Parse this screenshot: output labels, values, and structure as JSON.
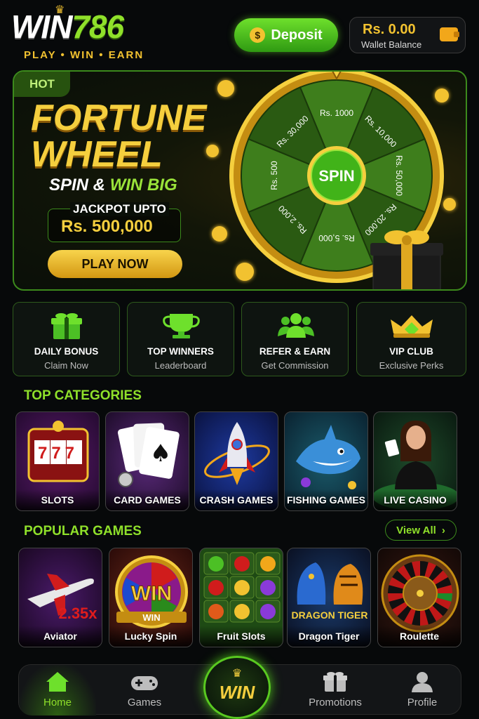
{
  "header": {
    "logo_win": "WIN",
    "logo_num": "786",
    "tagline": "PLAY • WIN • EARN",
    "deposit_label": "Deposit",
    "wallet_amount": "Rs. 0.00",
    "wallet_label": "Wallet Balance"
  },
  "banner": {
    "badge": "HOT",
    "title_line1": "FORTUNE",
    "title_line2": "WHEEL",
    "subtitle_a": "SPIN &",
    "subtitle_b": "WIN BIG",
    "jackpot_label": "JACKPOT UPTO",
    "jackpot_amount": "Rs. 500,000",
    "cta": "PLAY NOW",
    "spin_label": "SPIN",
    "wheel_prizes": [
      "Rs. 1000",
      "Rs. 10,000",
      "Rs. 50,000",
      "Rs. 20,000",
      "Rs. 5,000",
      "Rs. 2,000",
      "Rs. 500",
      "Rs. 30,000"
    ]
  },
  "quick_actions": [
    {
      "title": "DAILY BONUS",
      "subtitle": "Claim Now",
      "icon": "gift-icon"
    },
    {
      "title": "TOP WINNERS",
      "subtitle": "Leaderboard",
      "icon": "trophy-icon"
    },
    {
      "title": "REFER & EARN",
      "subtitle": "Get Commission",
      "icon": "users-icon"
    },
    {
      "title": "VIP CLUB",
      "subtitle": "Exclusive Perks",
      "icon": "crown-icon"
    }
  ],
  "categories": {
    "title": "TOP CATEGORIES",
    "items": [
      "SLOTS",
      "CARD GAMES",
      "CRASH GAMES",
      "FISHING GAMES",
      "LIVE CASINO"
    ]
  },
  "popular": {
    "title": "POPULAR GAMES",
    "view_all": "View All",
    "items": [
      "Aviator",
      "Lucky Spin",
      "Fruit Slots",
      "Dragon Tiger",
      "Roulette"
    ],
    "aviator_multiplier": "2.35x",
    "lucky_spin_art": "WIN",
    "lucky_spin_art2": "WIN",
    "dragon_tiger_art": "DRAGON TIGER",
    "slot_art": "777"
  },
  "nav": {
    "items": [
      "Home",
      "Games",
      "Promotions",
      "Profile"
    ],
    "center": "WIN",
    "active": "Home"
  },
  "colors": {
    "accent_green": "#8fe02a",
    "gold": "#f5cf3e",
    "background": "#07090a"
  }
}
